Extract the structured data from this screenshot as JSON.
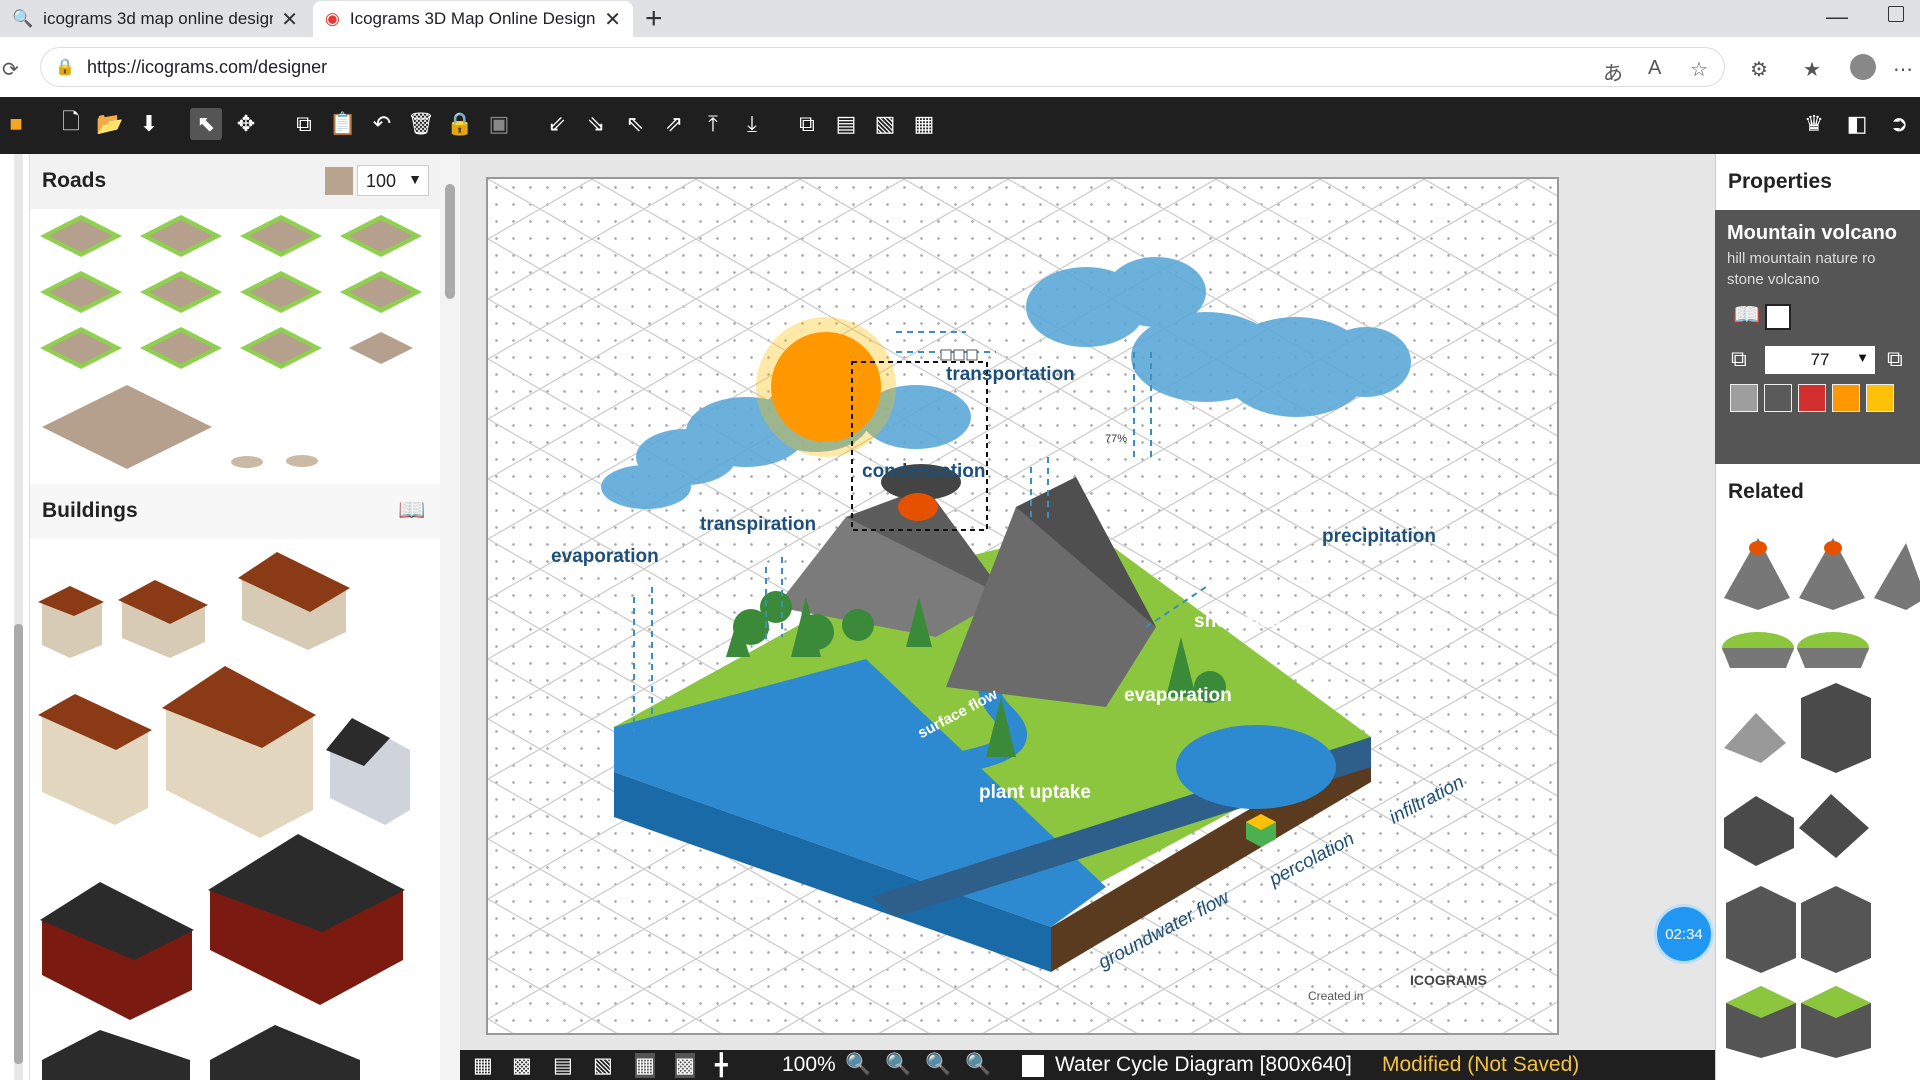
{
  "browser": {
    "tabs": [
      {
        "label": "icograms 3d map online designer"
      },
      {
        "label": "Icograms 3D Map Online Designer"
      }
    ],
    "url": "https://icograms.com/designer"
  },
  "toolbar": {
    "icons": [
      "new-file",
      "open-folder",
      "save",
      "select",
      "move",
      "copy",
      "paste",
      "undo",
      "delete",
      "lock",
      "group",
      "align-bottom-left",
      "align-bottom-right",
      "align-top-left",
      "align-top-right",
      "align-top",
      "align-bottom",
      "bring-front",
      "send-back",
      "bring-forward",
      "send-backward",
      "crown",
      "layout",
      "exit"
    ]
  },
  "left": {
    "roads_title": "Roads",
    "roads_size": "100",
    "buildings_title": "Buildings"
  },
  "canvas": {
    "labels": {
      "transportation": "transportation",
      "condensation": "condensation",
      "transpiration": "transpiration",
      "evaporation1": "evaporation",
      "precipitation": "precipitation",
      "snowmelt": "snowmelt",
      "evaporation2": "evaporation",
      "surface_flow": "surface flow",
      "plant_uptake": "plant uptake",
      "groundwater_flow": "groundwater flow",
      "percolation": "percolation",
      "infiltration": "infiltration",
      "selection_pct": "77%",
      "created_in": "Created in",
      "brand": "ICOGRAMS"
    },
    "timer": "02:34"
  },
  "statusbar": {
    "zoom": "100%",
    "document": "Water Cycle Diagram [800x640]",
    "state": "Modified (Not Saved)"
  },
  "right": {
    "properties_title": "Properties",
    "item_name": "Mountain volcano",
    "tags_line1": "hill  mountain  nature  ro",
    "tags_line2": "stone  volcano",
    "size_value": "77",
    "colors": [
      "#9e9e9e",
      "#5a5a5a",
      "#d32f2f",
      "#ff9800",
      "#ffc107"
    ],
    "related_title": "Related"
  }
}
